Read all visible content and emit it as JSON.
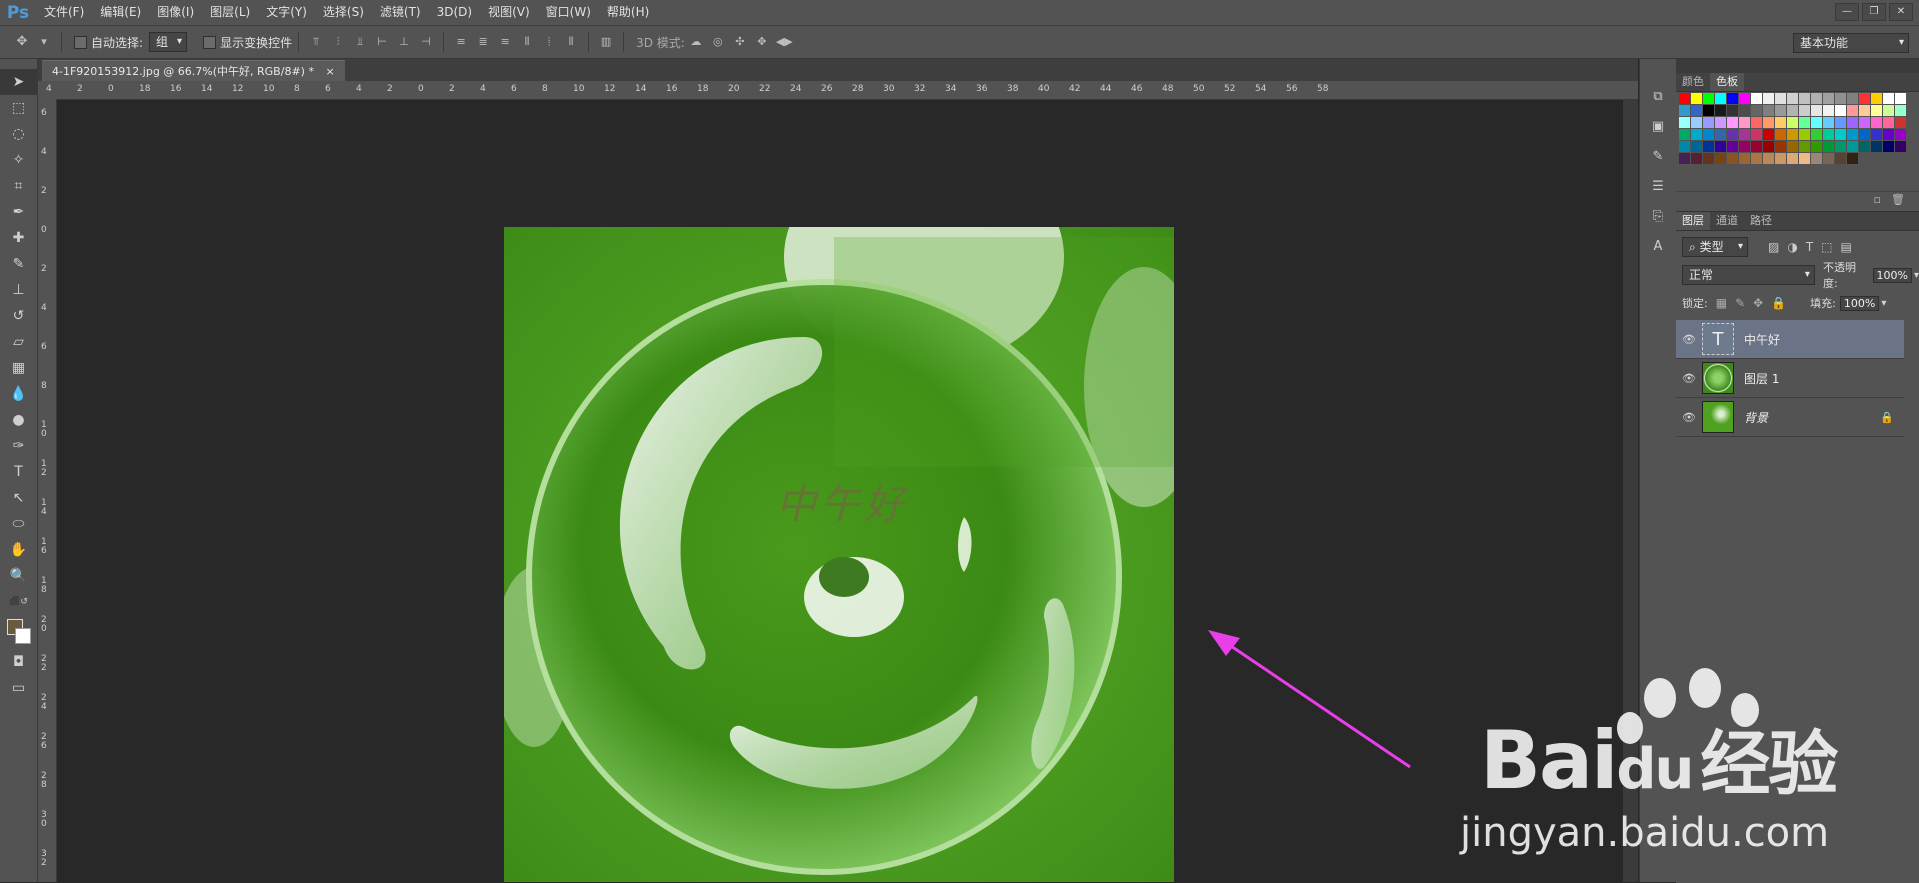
{
  "app": {
    "logo": "Ps"
  },
  "menu": [
    "文件(F)",
    "编辑(E)",
    "图像(I)",
    "图层(L)",
    "文字(Y)",
    "选择(S)",
    "滤镜(T)",
    "3D(D)",
    "视图(V)",
    "窗口(W)",
    "帮助(H)"
  ],
  "window_controls": {
    "minimize": "—",
    "restore": "❐",
    "close": "✕"
  },
  "options": {
    "auto_select_label": "自动选择:",
    "auto_select_value": "组",
    "show_transform_label": "显示变换控件",
    "mode_3d_label": "3D 模式:",
    "workspace": "基本功能"
  },
  "document": {
    "tab_title": "4-1F920153912.jpg @ 66.7%(中午好, RGB/8#) *",
    "tab_close": "×",
    "canvas_text": "中午好"
  },
  "ruler": {
    "h_labels": [
      "4",
      "2",
      "0",
      "18",
      "16",
      "14",
      "12",
      "10",
      "8",
      "6",
      "4",
      "2",
      "0",
      "2",
      "4",
      "6",
      "8",
      "10",
      "12",
      "14",
      "16",
      "18",
      "20",
      "22",
      "24",
      "26",
      "28",
      "30",
      "32",
      "34",
      "36",
      "38",
      "40",
      "42",
      "44",
      "46",
      "48",
      "50",
      "52",
      "54",
      "56",
      "58"
    ],
    "v_labels": [
      "6",
      "4",
      "2",
      "0",
      "2",
      "4",
      "6",
      "8",
      "1 0",
      "1 2",
      "1 4",
      "1 6",
      "1 8",
      "2 0",
      "2 2",
      "2 4",
      "2 6",
      "2 8",
      "3 0",
      "3 2"
    ]
  },
  "swatches_panel": {
    "tabs": [
      "颜色",
      "色板"
    ],
    "active_tab": 1,
    "colors": [
      "#ff0000",
      "#ffff00",
      "#00ff00",
      "#00ffff",
      "#0000ff",
      "#ff00ff",
      "#ffffff",
      "#f0f0f0",
      "#e0e0e0",
      "#d0d0d0",
      "#c0c0c0",
      "#b0b0b0",
      "#a0a0a0",
      "#909090",
      "#808080",
      "#ff3333",
      "#ffcc00",
      "#ffffff",
      "#ffffff",
      "#3399cc",
      "#3366cc",
      "#000000",
      "#1a1a1a",
      "#333333",
      "#4d4d4d",
      "#666666",
      "#7f7f7f",
      "#999999",
      "#b3b3b3",
      "#cccccc",
      "#e6e6e6",
      "#f2f2f2",
      "#ffffff",
      "#ff9999",
      "#ffcc99",
      "#ffff99",
      "#ccff99",
      "#99ffcc",
      "#99ffff",
      "#99ccff",
      "#9999ff",
      "#cc99ff",
      "#ff99ff",
      "#ff99cc",
      "#ff6666",
      "#ff9966",
      "#ffcc66",
      "#ccff66",
      "#66ff99",
      "#66ffff",
      "#66ccff",
      "#6699ff",
      "#9966ff",
      "#cc66ff",
      "#ff66cc",
      "#ff6699",
      "#cc3333",
      "#00aa66",
      "#00aacc",
      "#0088cc",
      "#3366aa",
      "#6633aa",
      "#aa3399",
      "#cc3366",
      "#cc0000",
      "#cc6600",
      "#cc9900",
      "#99cc00",
      "#33cc33",
      "#00cc99",
      "#00cccc",
      "#0099cc",
      "#0066cc",
      "#3333cc",
      "#6600cc",
      "#9900cc",
      "#0088aa",
      "#006699",
      "#003399",
      "#330099",
      "#660099",
      "#990066",
      "#990033",
      "#990000",
      "#993300",
      "#996600",
      "#669900",
      "#339900",
      "#009933",
      "#009966",
      "#009999",
      "#006666",
      "#003366",
      "#000066",
      "#330066",
      "#442255",
      "#552233",
      "#663322",
      "#774411",
      "#885522",
      "#996633",
      "#aa7744",
      "#bb8855",
      "#cc9966",
      "#ddaa77",
      "#eebb88",
      "#998877",
      "#776655",
      "#554433",
      "#332211"
    ]
  },
  "layers_panel": {
    "tabs": [
      "图层",
      "通道",
      "路径"
    ],
    "active_tab": 0,
    "filter_type": "类型",
    "blend_mode": "正常",
    "opacity_label": "不透明度:",
    "opacity_value": "100%",
    "lock_label": "锁定:",
    "fill_label": "填充:",
    "fill_value": "100%",
    "layers": [
      {
        "name": "中午好",
        "type": "text",
        "selected": true
      },
      {
        "name": "图层 1",
        "type": "image",
        "selected": false
      },
      {
        "name": "背景",
        "type": "background",
        "selected": false
      }
    ]
  },
  "watermark": {
    "brand": "Bai🐾经验",
    "brand_left": "Bai",
    "brand_mid": "du",
    "brand_right": "经验",
    "url": "jingyan.baidu.com"
  },
  "colors": {
    "accent_arrow": "#e83fe8",
    "ui_bg": "#535353",
    "canvas_bg": "#282828"
  }
}
